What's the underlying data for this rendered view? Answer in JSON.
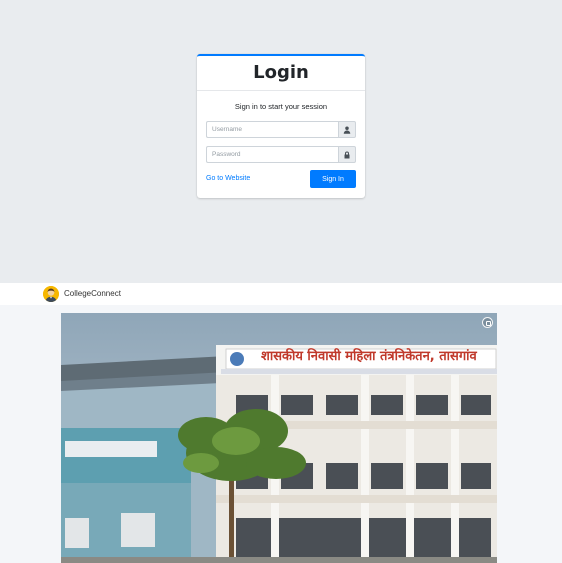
{
  "login": {
    "title": "Login",
    "subtitle": "Sign in to start your session",
    "username_placeholder": "Username",
    "password_placeholder": "Password",
    "website_link": "Go to Website",
    "signin_label": "Sign In"
  },
  "app": {
    "brand": "CollegeConnect"
  },
  "photo": {
    "banner": "शासकीय निवासी महिला तंत्रनिकेतन, तासगांव"
  },
  "colors": {
    "primary": "#007bff",
    "page_bg": "#e9ecef"
  },
  "icons": {
    "username": "user-icon",
    "password": "lock-icon",
    "expand": "expand-icon"
  }
}
